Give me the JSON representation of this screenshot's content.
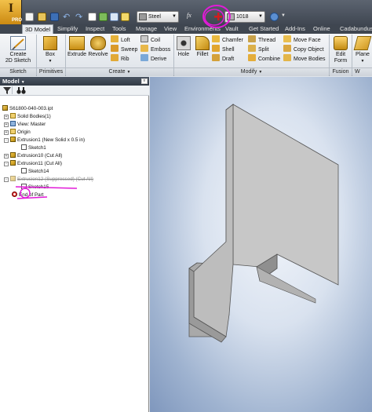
{
  "app": {
    "menu_glyph": "I",
    "edition": "PRO"
  },
  "quick_access": {
    "material": "Steel",
    "appearance": "1018",
    "formula_symbol": "fx"
  },
  "tabs": [
    {
      "label": "3D Model",
      "active": true
    },
    {
      "label": "Simplify"
    },
    {
      "label": "Inspect"
    },
    {
      "label": "Tools"
    },
    {
      "label": "Manage"
    },
    {
      "label": "View"
    },
    {
      "label": "Environments"
    },
    {
      "label": "Vault"
    },
    {
      "label": "Get Started"
    },
    {
      "label": "Add-Ins"
    },
    {
      "label": "Online"
    },
    {
      "label": "Cadabundus"
    }
  ],
  "ribbon": {
    "sketch": {
      "create_label_1": "Create",
      "create_label_2": "2D Sketch",
      "group_label": "Sketch"
    },
    "primitives": {
      "box_label": "Box",
      "group_label": "Primitives"
    },
    "create": {
      "extrude_label": "Extrude",
      "revolve_label": "Revolve",
      "loft_label": "Loft",
      "sweep_label": "Sweep",
      "rib_label": "Rib",
      "coil_label": "Coil",
      "emboss_label": "Emboss",
      "derive_label": "Derive",
      "group_label": "Create"
    },
    "modify": {
      "hole_label": "Hole",
      "fillet_label": "Fillet",
      "chamfer_label": "Chamfer",
      "shell_label": "Shell",
      "draft_label": "Draft",
      "thread_label": "Thread",
      "split_label": "Split",
      "combine_label": "Combine",
      "move_face_label": "Move Face",
      "copy_object_label": "Copy Object",
      "move_bodies_label": "Move Bodies",
      "group_label": "Modify"
    },
    "fusion": {
      "edit_form_label_1": "Edit",
      "edit_form_label_2": "Form",
      "group_label": "Fusion"
    },
    "partial": {
      "plane_label": "Plane",
      "group_label": "W"
    }
  },
  "browser": {
    "title": "Model",
    "tree": [
      {
        "label": "S61800-040-003.ipt",
        "indent": 0,
        "icon": "part-icon"
      },
      {
        "label": "Solid Bodies(1)",
        "indent": 1,
        "icon": "folder-icon",
        "expander": "+"
      },
      {
        "label": "View: Master",
        "indent": 1,
        "icon": "view-icon",
        "expander": "+"
      },
      {
        "label": "Origin",
        "indent": 1,
        "icon": "folder-icon",
        "expander": "+"
      },
      {
        "label": "Extrusion1 (New Solid x 0.5 in)",
        "indent": 1,
        "icon": "extrusion-icon",
        "expander": "-"
      },
      {
        "label": "Sketch1",
        "indent": 2,
        "icon": "sketch-icon"
      },
      {
        "label": "Extrusion10 (Cut All)",
        "indent": 1,
        "icon": "extrusion-icon",
        "expander": "+"
      },
      {
        "label": "Extrusion11 (Cut All)",
        "indent": 1,
        "icon": "extrusion-icon",
        "expander": "-"
      },
      {
        "label": "Sketch14",
        "indent": 2,
        "icon": "sketch-icon"
      },
      {
        "label": "Extrusion12 (Suppressed) (Cut All)",
        "indent": 1,
        "icon": "extrusion-icon",
        "expander": "-",
        "suppressed": true
      },
      {
        "label": "Sketch15",
        "indent": 2,
        "icon": "sketch-icon"
      },
      {
        "label": "End of Part",
        "indent": 1,
        "icon": "end-of-part-icon"
      }
    ]
  },
  "colors": {
    "annotation": "#e21ad8",
    "part_face_front": "#c7c7c7",
    "part_face_side": "#9d9d9d",
    "part_face_top": "#dadada"
  }
}
